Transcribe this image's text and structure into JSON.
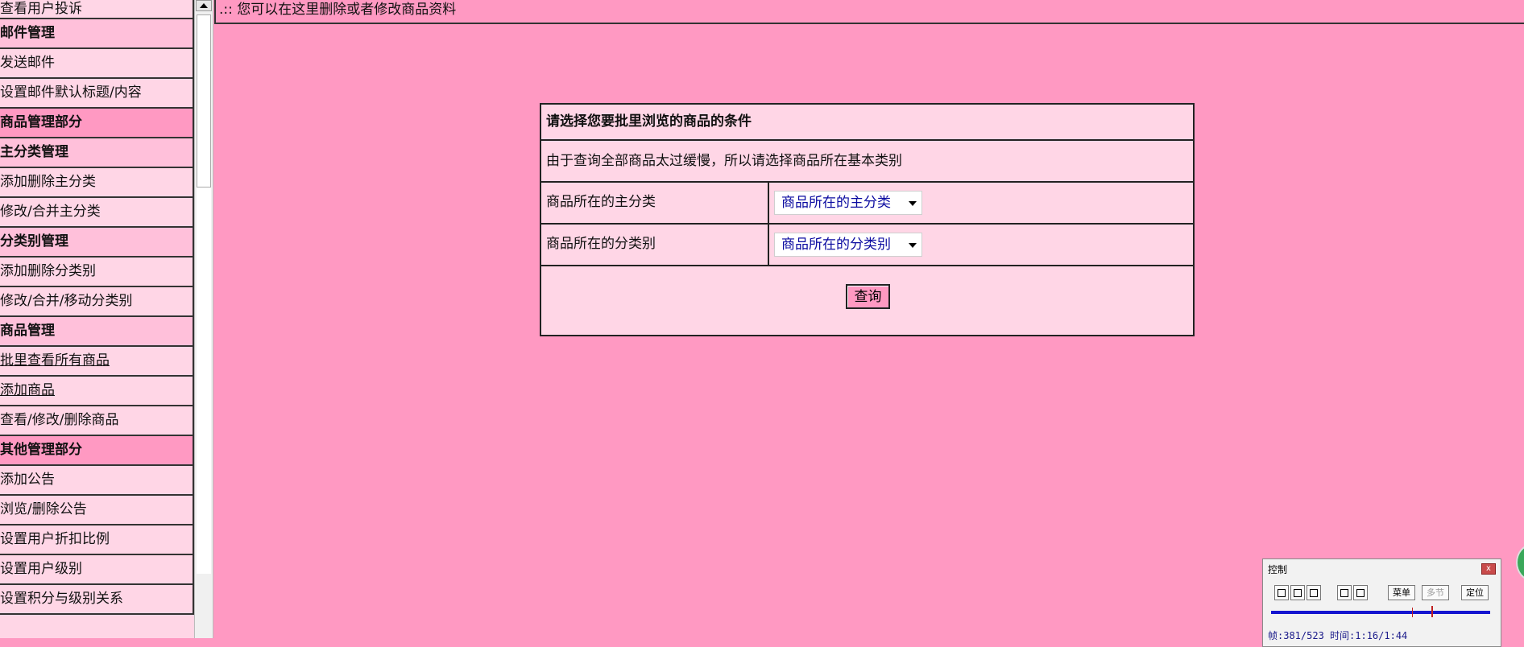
{
  "sidebar": {
    "items": [
      {
        "label": "查看用户投诉",
        "kind": "link"
      },
      {
        "label": "邮件管理",
        "kind": "header"
      },
      {
        "label": "发送邮件",
        "kind": "link"
      },
      {
        "label": "设置邮件默认标题/内容",
        "kind": "link"
      },
      {
        "label": "商品管理部分",
        "kind": "section"
      },
      {
        "label": "主分类管理",
        "kind": "header"
      },
      {
        "label": "添加删除主分类",
        "kind": "link"
      },
      {
        "label": "修改/合并主分类",
        "kind": "link"
      },
      {
        "label": "分类别管理",
        "kind": "header"
      },
      {
        "label": "添加删除分类别",
        "kind": "link"
      },
      {
        "label": "修改/合并/移动分类别",
        "kind": "link"
      },
      {
        "label": "商品管理",
        "kind": "header"
      },
      {
        "label": "批里查看所有商品",
        "kind": "link"
      },
      {
        "label": "添加商品",
        "kind": "link"
      },
      {
        "label": "查看/修改/删除商品",
        "kind": "link"
      },
      {
        "label": "其他管理部分",
        "kind": "section"
      },
      {
        "label": "添加公告",
        "kind": "link"
      },
      {
        "label": "浏览/删除公告",
        "kind": "link"
      },
      {
        "label": "设置用户折扣比例",
        "kind": "link"
      },
      {
        "label": "设置用户级别",
        "kind": "link"
      },
      {
        "label": "设置积分与级别关系",
        "kind": "link"
      }
    ]
  },
  "caption": ".:: 您可以在这里删除或者修改商品资料",
  "form": {
    "title": "请选择您要批里浏览的商品的条件",
    "note": "由于查询全部商品太过缓慢，所以请选择商品所在基本类别",
    "main_category_label": "商品所在的主分类",
    "main_category_value": "商品所在的主分类",
    "sub_category_label": "商品所在的分类别",
    "sub_category_value": "商品所在的分类别",
    "submit_label": "查询"
  },
  "control_window": {
    "title": "控制",
    "close_glyph": "x",
    "menu_label": "菜单",
    "multi_label": "多节",
    "locate_label": "定位",
    "status": "帧:381/523 时间:1:16/1:44"
  },
  "colors": {
    "page_background": "#ff99c2",
    "sidebar_background": "#ffd6e6",
    "select_text": "#0a0aa0",
    "progress_track": "#1515d0"
  }
}
